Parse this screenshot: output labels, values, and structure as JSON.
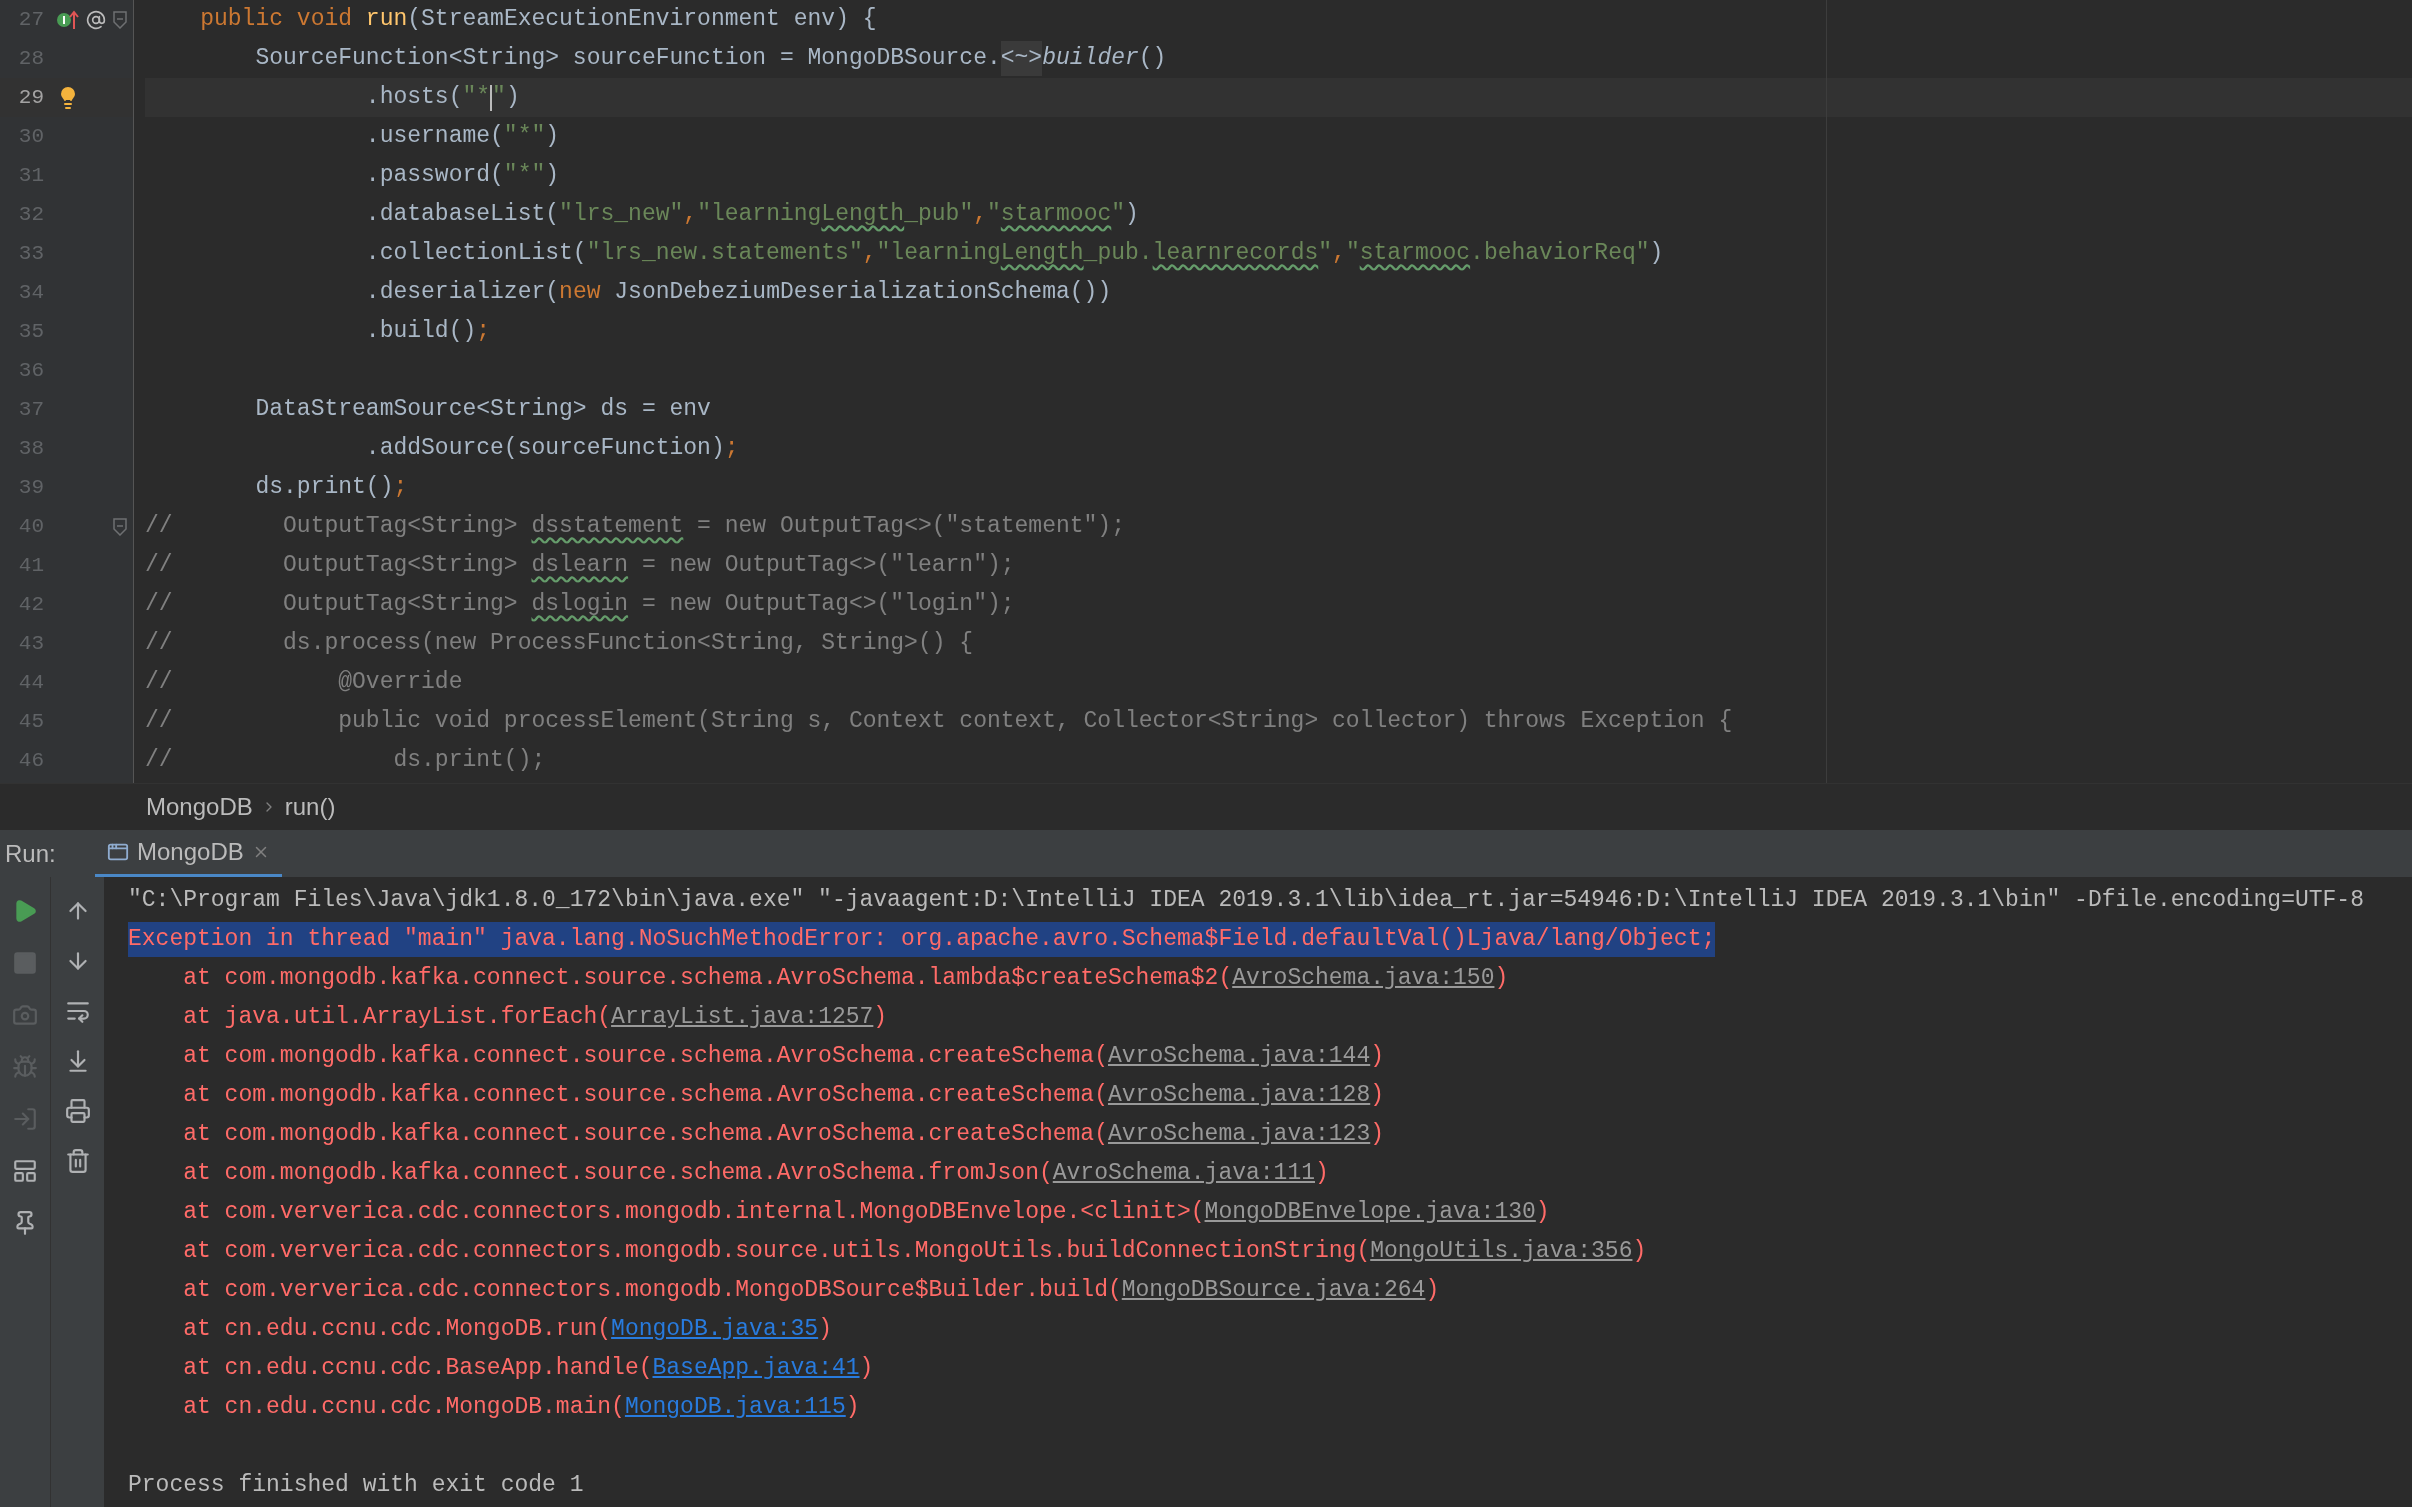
{
  "editor": {
    "lines": [
      {
        "number": "27",
        "current": false,
        "fold": true,
        "markers": [
          {
            "kind": "implements"
          },
          {
            "kind": "at"
          }
        ],
        "tokens": [
          {
            "kind": "kw",
            "text": "    public void "
          },
          {
            "kind": "fn",
            "text": "run"
          },
          {
            "kind": "plain",
            "text": "(StreamExecutionEnvironment env) {"
          }
        ]
      },
      {
        "number": "28",
        "current": false,
        "fold": false,
        "tokens": [
          {
            "kind": "plain",
            "text": "        SourceFunction<String> sourceFunction = MongoDBSource."
          },
          {
            "kind": "folded",
            "text": "<~>"
          },
          {
            "kind": "italic",
            "text": "builder"
          },
          {
            "kind": "plain",
            "text": "()"
          }
        ]
      },
      {
        "number": "29",
        "current": true,
        "fold": false,
        "markers": [
          {
            "kind": "bulb"
          }
        ],
        "tokens": [
          {
            "kind": "plain",
            "text": "                .hosts("
          },
          {
            "kind": "str",
            "text": "\"*"
          },
          {
            "kind": "caret"
          },
          {
            "kind": "str",
            "text": "\""
          },
          {
            "kind": "plain",
            "text": ")"
          }
        ]
      },
      {
        "number": "30",
        "current": false,
        "fold": false,
        "tokens": [
          {
            "kind": "plain",
            "text": "                .username("
          },
          {
            "kind": "str",
            "text": "\"*\""
          },
          {
            "kind": "plain",
            "text": ")"
          }
        ]
      },
      {
        "number": "31",
        "current": false,
        "fold": false,
        "tokens": [
          {
            "kind": "plain",
            "text": "                .password("
          },
          {
            "kind": "str",
            "text": "\"*\""
          },
          {
            "kind": "plain",
            "text": ")"
          }
        ]
      },
      {
        "number": "32",
        "current": false,
        "fold": false,
        "tokens": [
          {
            "kind": "plain",
            "text": "                .databaseList("
          },
          {
            "kind": "str",
            "text": "\"lrs_new\""
          },
          {
            "kind": "kw",
            "text": ","
          },
          {
            "kind": "str",
            "text": "\"learning"
          },
          {
            "kind": "str_typo",
            "text": "Length"
          },
          {
            "kind": "str",
            "text": "_pub\""
          },
          {
            "kind": "kw",
            "text": ","
          },
          {
            "kind": "str",
            "text": "\""
          },
          {
            "kind": "str_typo",
            "text": "starmooc"
          },
          {
            "kind": "str",
            "text": "\""
          },
          {
            "kind": "plain",
            "text": ")"
          }
        ]
      },
      {
        "number": "33",
        "current": false,
        "fold": false,
        "tokens": [
          {
            "kind": "plain",
            "text": "                .collectionList("
          },
          {
            "kind": "str",
            "text": "\"lrs_new.statements\""
          },
          {
            "kind": "kw",
            "text": ","
          },
          {
            "kind": "str",
            "text": "\"learning"
          },
          {
            "kind": "str_typo",
            "text": "Length"
          },
          {
            "kind": "str",
            "text": "_pub."
          },
          {
            "kind": "str_typo",
            "text": "learnrecords"
          },
          {
            "kind": "str",
            "text": "\""
          },
          {
            "kind": "kw",
            "text": ","
          },
          {
            "kind": "str",
            "text": "\""
          },
          {
            "kind": "str_typo",
            "text": "starmooc"
          },
          {
            "kind": "str",
            "text": ".behaviorReq\""
          },
          {
            "kind": "plain",
            "text": ")"
          }
        ]
      },
      {
        "number": "34",
        "current": false,
        "fold": false,
        "tokens": [
          {
            "kind": "plain",
            "text": "                .deserializer("
          },
          {
            "kind": "kw",
            "text": "new"
          },
          {
            "kind": "plain",
            "text": " JsonDebeziumDeserializationSchema())"
          }
        ]
      },
      {
        "number": "35",
        "current": false,
        "fold": false,
        "tokens": [
          {
            "kind": "plain",
            "text": "                .build()"
          },
          {
            "kind": "kw",
            "text": ";"
          }
        ]
      },
      {
        "number": "36",
        "current": false,
        "fold": false
      },
      {
        "number": "37",
        "current": false,
        "fold": false,
        "tokens": [
          {
            "kind": "plain",
            "text": "        DataStreamSource<String> ds = env"
          }
        ]
      },
      {
        "number": "38",
        "current": false,
        "fold": false,
        "tokens": [
          {
            "kind": "plain",
            "text": "                .addSource(sourceFunction)"
          },
          {
            "kind": "kw",
            "text": ";"
          }
        ]
      },
      {
        "number": "39",
        "current": false,
        "fold": false,
        "tokens": [
          {
            "kind": "plain",
            "text": "        ds.print()"
          },
          {
            "kind": "kw",
            "text": ";"
          }
        ]
      },
      {
        "number": "40",
        "current": false,
        "fold": true,
        "tokens": [
          {
            "kind": "comment",
            "text": "//        OutputTag<String> "
          },
          {
            "kind": "comment_typo",
            "text": "dsstatement"
          },
          {
            "kind": "comment",
            "text": " = new OutputTag<>(\"statement\");"
          }
        ]
      },
      {
        "number": "41",
        "current": false,
        "fold": false,
        "tokens": [
          {
            "kind": "comment",
            "text": "//        OutputTag<String> "
          },
          {
            "kind": "comment_typo",
            "text": "dslearn"
          },
          {
            "kind": "comment",
            "text": " = new OutputTag<>(\"learn\");"
          }
        ]
      },
      {
        "number": "42",
        "current": false,
        "fold": false,
        "tokens": [
          {
            "kind": "comment",
            "text": "//        OutputTag<String> "
          },
          {
            "kind": "comment_typo",
            "text": "dslogin"
          },
          {
            "kind": "comment",
            "text": " = new OutputTag<>(\"login\");"
          }
        ]
      },
      {
        "number": "43",
        "current": false,
        "fold": false,
        "tokens": [
          {
            "kind": "comment",
            "text": "//        ds.process(new ProcessFunction<String, String>() {"
          }
        ]
      },
      {
        "number": "44",
        "current": false,
        "fold": false,
        "tokens": [
          {
            "kind": "comment",
            "text": "//            @Override"
          }
        ]
      },
      {
        "number": "45",
        "current": false,
        "fold": false,
        "tokens": [
          {
            "kind": "comment",
            "text": "//            public void processElement(String s, Context context, Collector<String> collector) throws Exception {"
          }
        ]
      },
      {
        "number": "46",
        "current": false,
        "fold": false,
        "tokens": [
          {
            "kind": "comment",
            "text": "//                ds.print();"
          }
        ]
      }
    ]
  },
  "breadcrumbs": [
    "MongoDB",
    "run()"
  ],
  "run_panel": {
    "label": "Run:",
    "tabs": [
      {
        "label": "MongoDB",
        "selected": true
      }
    ],
    "toolbar_left": [
      {
        "kind": "play",
        "disabled": false
      },
      {
        "kind": "stop",
        "disabled": true
      },
      {
        "kind": "camera",
        "disabled": true
      },
      {
        "kind": "bug",
        "disabled": true
      },
      {
        "kind": "login",
        "disabled": true
      },
      {
        "kind": "layout",
        "disabled": false
      },
      {
        "kind": "pin",
        "disabled": false
      }
    ],
    "toolbar_right": [
      {
        "kind": "up",
        "disabled": false
      },
      {
        "kind": "down",
        "disabled": false
      },
      {
        "kind": "wrap",
        "disabled": false
      },
      {
        "kind": "scroll_end",
        "disabled": false
      },
      {
        "kind": "print",
        "disabled": false
      },
      {
        "kind": "trash",
        "disabled": false
      }
    ],
    "console": [
      {
        "kind": "command",
        "text": "\"C:\\Program Files\\Java\\jdk1.8.0_172\\bin\\java.exe\" \"-javaagent:D:\\IntelliJ IDEA 2019.3.1\\lib\\idea_rt.jar=54946:D:\\IntelliJ IDEA 2019.3.1\\bin\" -Dfile.encoding=UTF-8",
        "selected": false
      },
      {
        "kind": "error",
        "text": "Exception in thread \"main\" java.lang.NoSuchMethodError: org.apache.avro.Schema$Field.defaultVal()Ljava/lang/Object;",
        "selected": true
      },
      {
        "kind": "stack",
        "text": "    at com.mongodb.kafka.connect.source.schema.AvroSchema.lambda$createSchema$2(",
        "link": {
          "text": "AvroSchema.java:150",
          "kind": "library"
        },
        "suffix": ")",
        "selected": false
      },
      {
        "kind": "stack",
        "text": "    at java.util.ArrayList.forEach(",
        "link": {
          "text": "ArrayList.java:1257",
          "kind": "library"
        },
        "suffix": ")",
        "selected": false
      },
      {
        "kind": "stack",
        "text": "    at com.mongodb.kafka.connect.source.schema.AvroSchema.createSchema(",
        "link": {
          "text": "AvroSchema.java:144",
          "kind": "library"
        },
        "suffix": ")",
        "selected": false
      },
      {
        "kind": "stack",
        "text": "    at com.mongodb.kafka.connect.source.schema.AvroSchema.createSchema(",
        "link": {
          "text": "AvroSchema.java:128",
          "kind": "library"
        },
        "suffix": ")",
        "selected": false
      },
      {
        "kind": "stack",
        "text": "    at com.mongodb.kafka.connect.source.schema.AvroSchema.createSchema(",
        "link": {
          "text": "AvroSchema.java:123",
          "kind": "library"
        },
        "suffix": ")",
        "selected": false
      },
      {
        "kind": "stack",
        "text": "    at com.mongodb.kafka.connect.source.schema.AvroSchema.fromJson(",
        "link": {
          "text": "AvroSchema.java:111",
          "kind": "library"
        },
        "suffix": ")",
        "selected": false
      },
      {
        "kind": "stack",
        "text": "    at com.ververica.cdc.connectors.mongodb.internal.MongoDBEnvelope.<clinit>(",
        "link": {
          "text": "MongoDBEnvelope.java:130",
          "kind": "library"
        },
        "suffix": ")",
        "selected": false
      },
      {
        "kind": "stack",
        "text": "    at com.ververica.cdc.connectors.mongodb.source.utils.MongoUtils.buildConnectionString(",
        "link": {
          "text": "MongoUtils.java:356",
          "kind": "library"
        },
        "suffix": ")",
        "selected": false
      },
      {
        "kind": "stack",
        "text": "    at com.ververica.cdc.connectors.mongodb.MongoDBSource$Builder.build(",
        "link": {
          "text": "MongoDBSource.java:264",
          "kind": "library"
        },
        "suffix": ")",
        "selected": false
      },
      {
        "kind": "stack",
        "text": "    at cn.edu.ccnu.cdc.MongoDB.run(",
        "link": {
          "text": "MongoDB.java:35",
          "kind": "source"
        },
        "suffix": ")",
        "selected": false
      },
      {
        "kind": "stack",
        "text": "    at cn.edu.ccnu.cdc.BaseApp.handle(",
        "link": {
          "text": "BaseApp.java:41",
          "kind": "source"
        },
        "suffix": ")",
        "selected": false
      },
      {
        "kind": "stack",
        "text": "    at cn.edu.ccnu.cdc.MongoDB.main(",
        "link": {
          "text": "MongoDB.java:115",
          "kind": "source"
        },
        "suffix": ")",
        "selected": false
      },
      {
        "kind": "blank"
      },
      {
        "kind": "exit",
        "text": "Process finished with exit code 1",
        "selected": false
      }
    ]
  }
}
